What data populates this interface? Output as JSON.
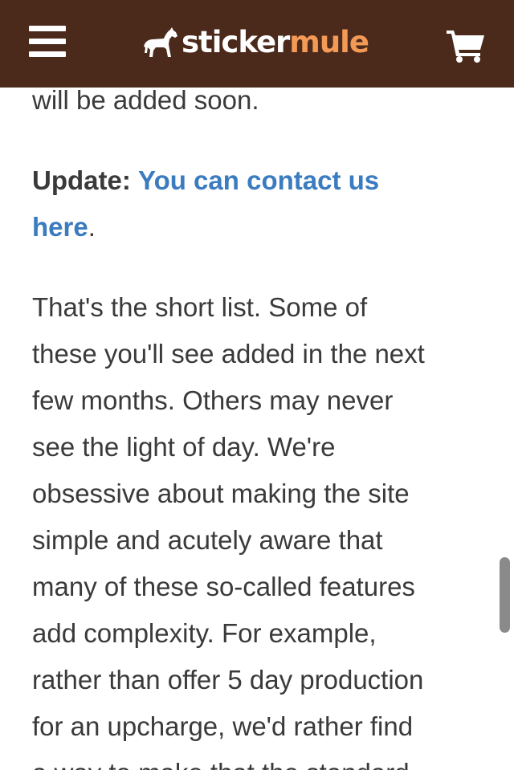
{
  "header": {
    "brand_part1": "sticker",
    "brand_part2": "mule",
    "menu_icon": "hamburger-menu-icon",
    "cart_icon": "shopping-cart-icon",
    "background_color": "#4b2a1c",
    "brand_accent_color": "#f39a56"
  },
  "article": {
    "top_fragment": "will be added soon.",
    "update_label": "Update:",
    "update_link_line1": "You can contact us",
    "update_link_line2": "here",
    "update_period": ".",
    "body_lines": [
      "That's the short list. Some of",
      "these you'll see added in the next",
      "few months. Others may never",
      "see the light of day. We're",
      "obsessive about making the site",
      "simple and acutely aware that",
      "many of these so-called features",
      "add complexity. For example,",
      "rather than offer 5 day production",
      "for an upcharge, we'd rather find",
      "a way to make that the standard"
    ],
    "link_color": "#3b7bbf"
  }
}
